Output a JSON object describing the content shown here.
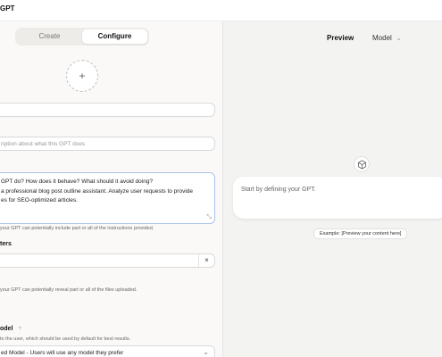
{
  "topbar": {
    "title": "GPT"
  },
  "tabs": [
    {
      "label": "Create"
    },
    {
      "label": "Configure"
    }
  ],
  "avatar": {
    "icon": "plus-icon",
    "glyph": "+"
  },
  "fields": {
    "name": {
      "value": ""
    },
    "description": {
      "placeholder": "ription about what this GPT does"
    },
    "instructions": {
      "value": "GPT do? How does it behave? What should it avoid doing?\na professional blog post outline assistant. Analyze user requests to provide\nes for SEO-optimized articles.",
      "help": "your GPT can potentially include part or all of the instructions provided."
    },
    "starters": {
      "label": "ters",
      "value": "",
      "clear": "×"
    },
    "knowledge": {
      "help": "your GPT can potentially reveal part or all of the files uploaded."
    },
    "model": {
      "label": "odel",
      "info": "?",
      "help": "to the user, which should be used by default for best results.",
      "value": "ed Model - Users will use any model they prefer"
    }
  },
  "preview": {
    "title": "Preview",
    "model_selector": "Model",
    "cube_icon": "cube-icon",
    "placeholder": "Start by defining your GPT.",
    "example": "Example: [Preview your content here]"
  },
  "colors": {
    "focus_border": "#a9c3ea",
    "panel_bg": "#faf9f8",
    "preview_bg": "#f3f3f2"
  }
}
